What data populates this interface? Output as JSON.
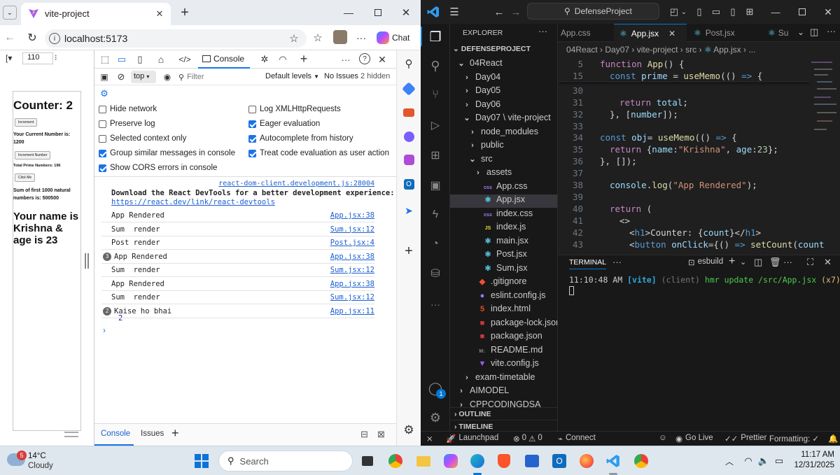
{
  "browser": {
    "tab_title": "vite-project",
    "url": "localhost:5173",
    "chat_label": "Chat",
    "zoom_value": "110",
    "preview": {
      "counter": "Counter: 2",
      "increment_label": "Increment",
      "current_number": "Your Current Number is: 1200",
      "increment_number_label": "Increment Number",
      "total_primes": "Total Prime Numbers: 196",
      "click_me_label": "Click Me",
      "sum_text": "Sum of first 1000 natural numbers is: 500500",
      "name_text": "Your name is Krishna & age is 23"
    },
    "devtools": {
      "console_tab": "Console",
      "context": "top",
      "filter_placeholder": "Filter",
      "levels": "Default levels",
      "issues": "No Issues",
      "hidden": "2 hidden",
      "options": [
        {
          "label": "Hide network",
          "checked": false
        },
        {
          "label": "Log XMLHttpRequests",
          "checked": false
        },
        {
          "label": "Preserve log",
          "checked": false
        },
        {
          "label": "Eager evaluation",
          "checked": true
        },
        {
          "label": "Selected context only",
          "checked": false
        },
        {
          "label": "Autocomplete from history",
          "checked": true
        },
        {
          "label": "Group similar messages in console",
          "checked": true
        },
        {
          "label": "Treat code evaluation as user action",
          "checked": true
        },
        {
          "label": "Show CORS errors in console",
          "checked": true
        }
      ],
      "devtools_source": "react-dom-client.development.js:28004",
      "devtools_msg": "Download the React DevTools for a better development experience:",
      "devtools_link": "https://react.dev/link/react-devtools",
      "logs": [
        {
          "count": "",
          "msg": "App Rendered",
          "src": "App.jsx:38"
        },
        {
          "count": "",
          "msg": "Sum  render",
          "src": "Sum.jsx:12"
        },
        {
          "count": "",
          "msg": "Post render",
          "src": "Post.jsx:4"
        },
        {
          "count": "3",
          "msg": "App Rendered",
          "src": "App.jsx:38"
        },
        {
          "count": "",
          "msg": "Sum  render",
          "src": "Sum.jsx:12"
        },
        {
          "count": "",
          "msg": "App Rendered",
          "src": "App.jsx:38"
        },
        {
          "count": "",
          "msg": "Sum  render",
          "src": "Sum.jsx:12"
        },
        {
          "count": "2",
          "msg": "Kaise ho bhai",
          "src": "App.jsx:11"
        }
      ],
      "log_value": "2",
      "bottom_tabs": [
        "Console",
        "Issues"
      ]
    }
  },
  "vscode": {
    "search": "DefenseProject",
    "explorer_title": "EXPLORER",
    "project": "DEFENSEPROJECT",
    "tabs": [
      "App.css",
      "App.jsx",
      "Post.jsx",
      "Su"
    ],
    "breadcrumb": [
      "04React",
      "Day07",
      "vite-project",
      "src",
      "App.jsx",
      "..."
    ],
    "tree": [
      {
        "label": "04React",
        "depth": 0,
        "type": "folder-open"
      },
      {
        "label": "Day04",
        "depth": 1,
        "type": "folder"
      },
      {
        "label": "Day05",
        "depth": 1,
        "type": "folder"
      },
      {
        "label": "Day06",
        "depth": 1,
        "type": "folder"
      },
      {
        "label": "Day07 \\ vite-project",
        "depth": 1,
        "type": "folder-open"
      },
      {
        "label": "node_modules",
        "depth": 2,
        "type": "folder"
      },
      {
        "label": "public",
        "depth": 2,
        "type": "folder"
      },
      {
        "label": "src",
        "depth": 2,
        "type": "folder-open"
      },
      {
        "label": "assets",
        "depth": 3,
        "type": "folder"
      },
      {
        "label": "App.css",
        "depth": 4,
        "type": "css"
      },
      {
        "label": "App.jsx",
        "depth": 4,
        "type": "react"
      },
      {
        "label": "index.css",
        "depth": 4,
        "type": "css"
      },
      {
        "label": "index.js",
        "depth": 4,
        "type": "js"
      },
      {
        "label": "main.jsx",
        "depth": 4,
        "type": "react"
      },
      {
        "label": "Post.jsx",
        "depth": 4,
        "type": "react"
      },
      {
        "label": "Sum.jsx",
        "depth": 4,
        "type": "react"
      },
      {
        "label": ".gitignore",
        "depth": 3,
        "type": "git"
      },
      {
        "label": "eslint.config.js",
        "depth": 3,
        "type": "eslint"
      },
      {
        "label": "index.html",
        "depth": 3,
        "type": "html"
      },
      {
        "label": "package-lock.json",
        "depth": 3,
        "type": "npm"
      },
      {
        "label": "package.json",
        "depth": 3,
        "type": "npm"
      },
      {
        "label": "README.md",
        "depth": 3,
        "type": "md"
      },
      {
        "label": "vite.config.js",
        "depth": 3,
        "type": "vite"
      },
      {
        "label": "exam-timetable",
        "depth": 1,
        "type": "folder"
      },
      {
        "label": "AIMODEL",
        "depth": 0,
        "type": "folder"
      },
      {
        "label": "CPPCODINGDSA",
        "depth": 0,
        "type": "folder"
      }
    ],
    "outline": "OUTLINE",
    "timeline": "TIMELINE",
    "code": [
      {
        "n": "5",
        "html": "<span class='kw'>function</span> <span class='fn'>App</span><span class='pl'>() {</span>",
        "indent": 0
      },
      {
        "n": "15",
        "html": "<span class='kb'>const</span> <span class='vr'>prime</span> <span class='pl'>=</span> <span class='fn'>useMemo</span><span class='pl'>(() </span><span class='kb'>=&gt;</span><span class='pl'> {</span>",
        "indent": 1
      },
      {
        "n": "30",
        "html": "",
        "indent": 0
      },
      {
        "n": "31",
        "html": "<span class='kw'>return</span> <span class='vr'>total</span><span class='pl'>;</span>",
        "indent": 2
      },
      {
        "n": "32",
        "html": "<span class='pl'>}, [</span><span class='vr'>number</span><span class='pl'>]);</span>",
        "indent": 1
      },
      {
        "n": "33",
        "html": "",
        "indent": 0
      },
      {
        "n": "34",
        "html": "<span class='kb'>const</span> <span class='vr'>obj</span><span class='pl'>= </span><span class='fn'>useMemo</span><span class='pl'>(() </span><span class='kb'>=&gt;</span><span class='pl'> {</span>",
        "indent": 0
      },
      {
        "n": "35",
        "html": "<span class='kw'>return</span> <span class='pl'>{</span><span class='vr'>name</span><span class='pl'>:</span><span class='st'>\"Krishna\"</span><span class='pl'>, </span><span class='vr'>age</span><span class='pl'>:</span><span class='nm'>23</span><span class='pl'>};</span>",
        "indent": 1
      },
      {
        "n": "36",
        "html": "<span class='pl'>}, []);</span>",
        "indent": 0
      },
      {
        "n": "37",
        "html": "",
        "indent": 0
      },
      {
        "n": "38",
        "html": "<span class='vr'>console</span><span class='pl'>.</span><span class='fn'>log</span><span class='pl'>(</span><span class='st'>\"App Rendered\"</span><span class='pl'>);</span>",
        "indent": 1
      },
      {
        "n": "39",
        "html": "",
        "indent": 0
      },
      {
        "n": "40",
        "html": "<span class='kw'>return</span> <span class='pl'>(</span>",
        "indent": 1
      },
      {
        "n": "41",
        "html": "<span class='pl'>&lt;&gt;</span>",
        "indent": 2
      },
      {
        "n": "42",
        "html": "<span class='pl'>&lt;</span><span class='tg'>h1</span><span class='pl'>&gt;Counter: {</span><span class='vr'>count</span><span class='pl'>}&lt;/</span><span class='tg'>h1</span><span class='pl'>&gt;</span>",
        "indent": 3
      },
      {
        "n": "43",
        "html": "<span class='pl'>&lt;</span><span class='tg'>button</span> <span class='vr'>onClick</span><span class='pl'>={() </span><span class='kb'>=&gt;</span> <span class='fn'>setCount</span><span class='pl'>(</span><span class='vr'>count</span>",
        "indent": 3
      }
    ],
    "terminal_tab": "TERMINAL",
    "terminal_shell": "esbuild",
    "terminal_line": {
      "time": "11:10:48 AM",
      "tag": "[vite]",
      "client": "(client)",
      "msg": "hmr update /src/App.jsx",
      "count": "(x7)"
    },
    "status": {
      "launchpad": "Launchpad",
      "errors": "0",
      "warnings": "0",
      "connect": "Connect",
      "golive": "Go Live",
      "prettier": "Prettier",
      "formatting": "Formatting: ✓"
    },
    "notif_count": "1"
  },
  "taskbar": {
    "weather_temp": "14°C",
    "weather_desc": "Cloudy",
    "weather_badge": "5",
    "search": "Search",
    "time": "11:17 AM",
    "date": "12/31/2025"
  },
  "colors": {
    "accent": "#1a73e8",
    "vscode_blue": "#0078d4",
    "link": "#1a5fd0"
  }
}
